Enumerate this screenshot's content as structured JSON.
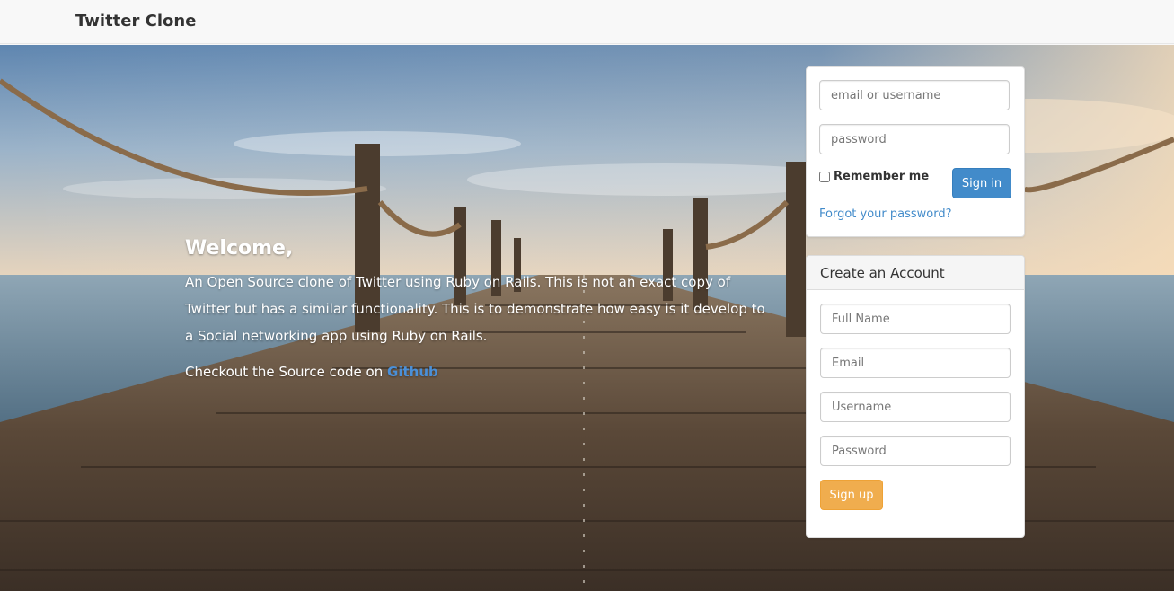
{
  "navbar": {
    "brand": "Twitter Clone"
  },
  "welcome": {
    "heading": "Welcome,",
    "description": "An Open Source clone of Twitter using Ruby on Rails. This is not an exact copy of Twitter but has a similar functionality. This is to demonstrate how easy is it develop to a Social networking app using Ruby on Rails.",
    "source_prefix": "Checkout the Source code on ",
    "source_link": "Github"
  },
  "login": {
    "login_placeholder": "email or username",
    "password_placeholder": "password",
    "remember_label": "Remember me",
    "submit_label": "Sign in",
    "forgot_label": "Forgot your password?"
  },
  "signup": {
    "title": "Create an Account",
    "full_name_placeholder": "Full Name",
    "email_placeholder": "Email",
    "username_placeholder": "Username",
    "password_placeholder": "Password",
    "submit_label": "Sign up"
  },
  "colors": {
    "primary": "#428bca",
    "warning": "#f0ad4e",
    "link": "#4a90d9"
  }
}
